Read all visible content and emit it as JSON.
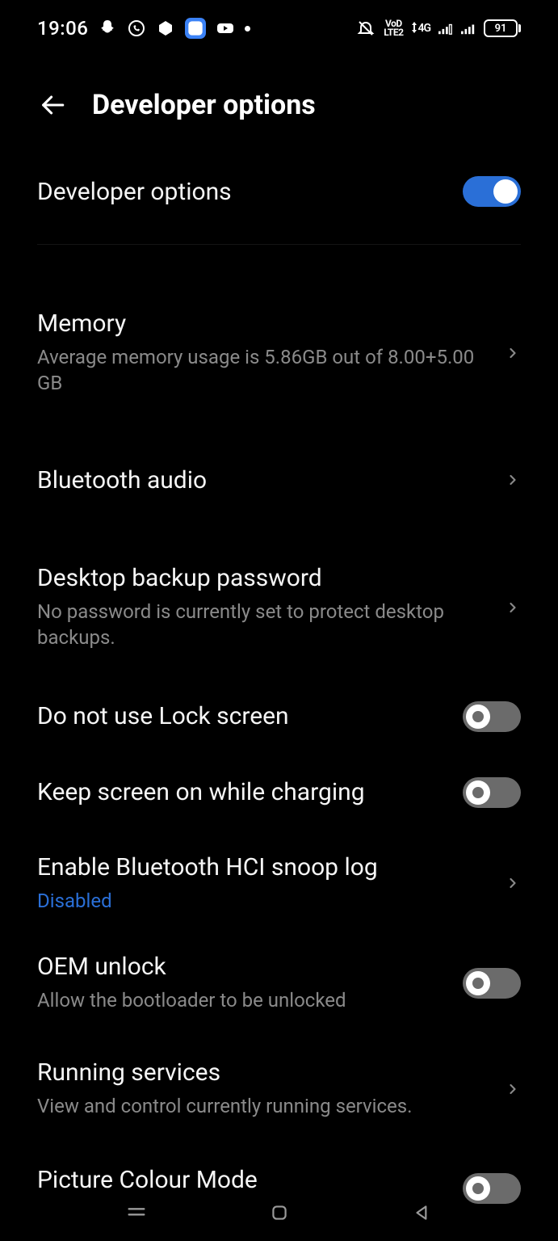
{
  "status": {
    "time": "19:06",
    "volte": "VoD\nLTE2",
    "net": "4G",
    "battery": "91"
  },
  "header": {
    "title": "Developer options"
  },
  "rows": {
    "devopt": {
      "title": "Developer options",
      "on": true
    },
    "memory": {
      "title": "Memory",
      "sub": "Average memory usage is 5.86GB out of 8.00+5.00 GB"
    },
    "btaudio": {
      "title": "Bluetooth audio"
    },
    "desktop": {
      "title": "Desktop backup password",
      "sub": "No password is currently set to protect desktop backups."
    },
    "nolock": {
      "title": "Do not use Lock screen",
      "on": false
    },
    "keepscreen": {
      "title": "Keep screen on while charging",
      "on": false
    },
    "hcisnoop": {
      "title": "Enable Bluetooth HCI snoop log",
      "sub": "Disabled"
    },
    "oem": {
      "title": "OEM unlock",
      "sub": "Allow the bootloader to be unlocked",
      "on": false
    },
    "running": {
      "title": "Running services",
      "sub": "View and control currently running services."
    },
    "picture": {
      "title": "Picture Colour Mode",
      "on": false
    }
  }
}
